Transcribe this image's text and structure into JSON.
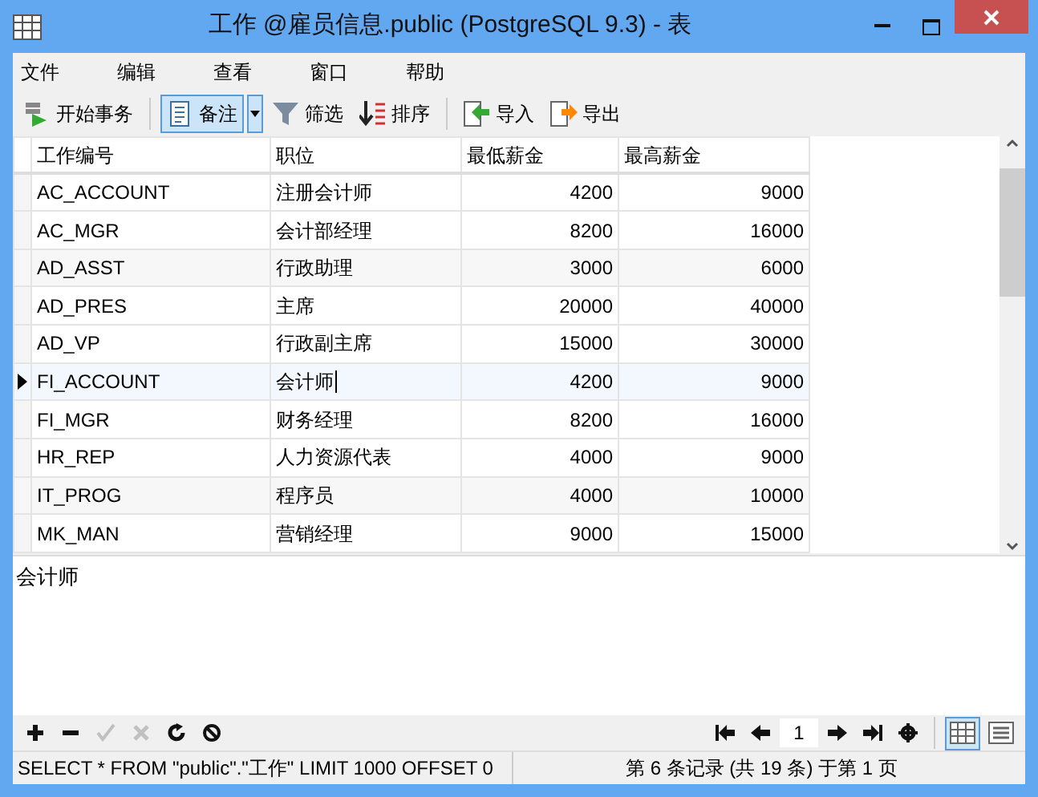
{
  "window": {
    "title": "工作 @雇员信息.public (PostgreSQL 9.3) - 表"
  },
  "menu": [
    "文件",
    "编辑",
    "查看",
    "窗口",
    "帮助"
  ],
  "toolbar": [
    {
      "kind": "transaction",
      "label": "开始事务",
      "selected": false
    },
    {
      "kind": "memo",
      "label": "备注",
      "selected": true
    },
    {
      "kind": "filter",
      "label": "筛选",
      "selected": false
    },
    {
      "kind": "sort",
      "label": "排序",
      "selected": false
    },
    {
      "kind": "import",
      "label": "导入",
      "selected": false
    },
    {
      "kind": "export",
      "label": "导出",
      "selected": false
    }
  ],
  "table": {
    "columns": [
      "工作编号",
      "职位",
      "最低薪金",
      "最高薪金"
    ],
    "rows": [
      {
        "cells": [
          "AC_ACCOUNT",
          "注册会计师",
          "4200",
          "9000"
        ],
        "selected": false
      },
      {
        "cells": [
          "AC_MGR",
          "会计部经理",
          "8200",
          "16000"
        ],
        "selected": false
      },
      {
        "cells": [
          "AD_ASST",
          "行政助理",
          "3000",
          "6000"
        ],
        "selected": false
      },
      {
        "cells": [
          "AD_PRES",
          "主席",
          "20000",
          "40000"
        ],
        "selected": false
      },
      {
        "cells": [
          "AD_VP",
          "行政副主席",
          "15000",
          "30000"
        ],
        "selected": false
      },
      {
        "cells": [
          "FI_ACCOUNT",
          "会计师",
          "4200",
          "9000"
        ],
        "selected": true
      },
      {
        "cells": [
          "FI_MGR",
          "财务经理",
          "8200",
          "16000"
        ],
        "selected": false
      },
      {
        "cells": [
          "HR_REP",
          "人力资源代表",
          "4000",
          "9000"
        ],
        "selected": false
      },
      {
        "cells": [
          "IT_PROG",
          "程序员",
          "4000",
          "10000"
        ],
        "selected": false
      },
      {
        "cells": [
          "MK_MAN",
          "营销经理",
          "9000",
          "15000"
        ],
        "selected": false
      }
    ]
  },
  "memo": {
    "value": "会计师"
  },
  "record_buttons": [
    {
      "kind": "add",
      "disabled": false
    },
    {
      "kind": "delete",
      "disabled": false
    },
    {
      "kind": "apply",
      "disabled": true
    },
    {
      "kind": "cancel",
      "disabled": true
    },
    {
      "kind": "refresh",
      "disabled": false
    },
    {
      "kind": "stop",
      "disabled": false
    }
  ],
  "pager": {
    "page": "1"
  },
  "views": [
    {
      "kind": "grid",
      "selected": true
    },
    {
      "kind": "form",
      "selected": false
    }
  ],
  "status_bar": {
    "query": "SELECT * FROM \"public\".\"工作\" LIMIT 1000 OFFSET 0",
    "records": "第 6 条记录 (共 19 条) 于第 1 页"
  }
}
